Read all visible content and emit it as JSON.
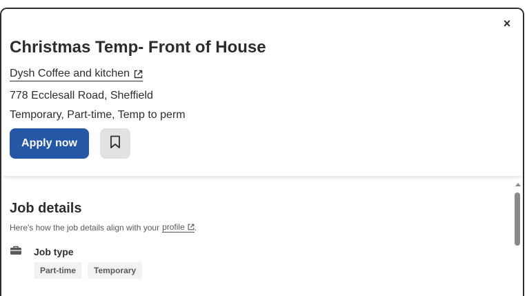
{
  "job": {
    "title": "Christmas Temp- Front of House",
    "company": "Dysh Coffee and kitchen",
    "location": "778 Ecclesall Road, Sheffield",
    "job_types_line": "Temporary, Part-time, Temp to perm"
  },
  "actions": {
    "apply_label": "Apply now",
    "close_glyph": "×"
  },
  "details": {
    "title": "Job details",
    "subtitle_prefix": "Here's how the job details align with your",
    "profile_link": "profile",
    "subtitle_suffix": ".",
    "job_type_label": "Job type",
    "job_type_tags": [
      "Part-time",
      "Temporary"
    ]
  },
  "icons": {
    "close": "close-icon",
    "external_link": "external-link-icon",
    "bookmark": "bookmark-icon",
    "briefcase": "briefcase-icon"
  },
  "colors": {
    "primary": "#2557a7",
    "text": "#2d2d2d",
    "muted": "#595959",
    "tag_bg": "#f3f2f1",
    "save_bg": "#e4e2e0"
  }
}
